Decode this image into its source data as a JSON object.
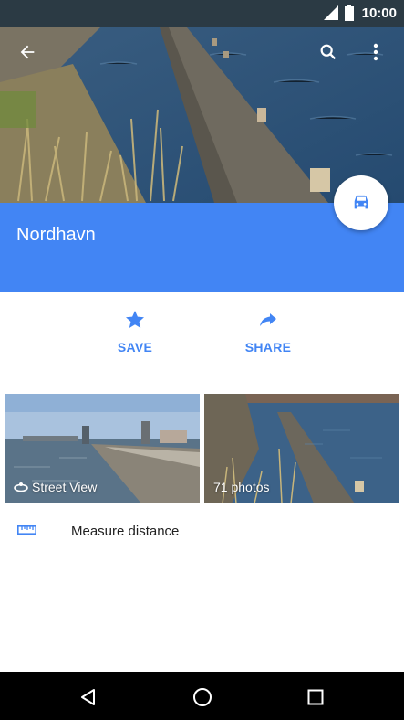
{
  "status_bar": {
    "time": "10:00",
    "icons": [
      "signal-icon",
      "battery-icon"
    ]
  },
  "top_bar": {
    "back_icon": "arrow-back-icon",
    "search_icon": "search-icon",
    "more_icon": "more-vert-icon"
  },
  "place": {
    "name": "Nordhavn"
  },
  "fab": {
    "icon": "car-icon"
  },
  "actions": [
    {
      "label": "SAVE",
      "icon": "star-icon"
    },
    {
      "label": "SHARE",
      "icon": "share-icon"
    }
  ],
  "photos": [
    {
      "caption": "Street View",
      "icon": "street-view-icon"
    },
    {
      "caption": "71 photos"
    }
  ],
  "measure": {
    "label": "Measure distance",
    "icon": "ruler-icon"
  },
  "navbar": {
    "icons": [
      "back-triangle-icon",
      "home-circle-icon",
      "recents-square-icon"
    ]
  },
  "colors": {
    "accent": "#4285f4",
    "navbar": "#000000"
  }
}
